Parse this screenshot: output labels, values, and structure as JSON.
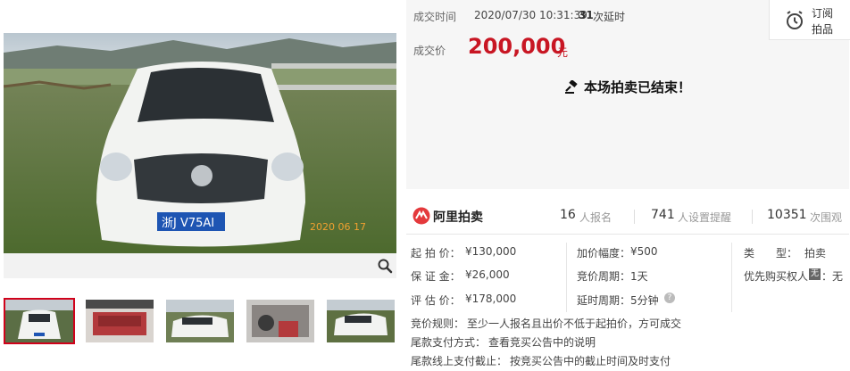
{
  "deal": {
    "time_label": "成交时间",
    "time_value": "2020/07/30 10:31:39",
    "delay_count": "31",
    "delay_label": "次延时",
    "price_label": "成交价",
    "price_value": "200,000",
    "price_unit": "元"
  },
  "subscribe": {
    "line1": "订阅",
    "line2": "拍品"
  },
  "status_message": "本场拍卖已结束！",
  "photo": {
    "plate": "浙J V75AI",
    "date_stamp": "2020 06 17"
  },
  "brand": {
    "name": "阿里拍卖"
  },
  "stats": [
    {
      "num": "16",
      "label": "人报名"
    },
    {
      "num": "741",
      "label": "人设置提醒"
    },
    {
      "num": "10351",
      "label": "次围观"
    }
  ],
  "details": {
    "col1": [
      {
        "label": "起 拍 价：",
        "value": "¥130,000"
      },
      {
        "label": "保 证 金：",
        "value": "¥26,000"
      },
      {
        "label": "评 估 价：",
        "value": "¥178,000"
      }
    ],
    "col2": [
      {
        "label": "加价幅度：",
        "value": "¥500"
      },
      {
        "label": "竞价周期：",
        "value": "1天"
      },
      {
        "label": "延时周期：",
        "value": "5分钟"
      }
    ],
    "col3": [
      {
        "label": "类　　型：",
        "value": "拍卖"
      },
      {
        "label": "优先购买权人",
        "badge": "无",
        "value": "：无"
      }
    ]
  },
  "rules": [
    {
      "label": "竞价规则：",
      "value": "至少一人报名且出价不低于起拍价，方可成交"
    },
    {
      "label": "尾款支付方式：",
      "value": "查看竞买公告中的说明"
    },
    {
      "label": "尾款线上支付截止：",
      "value": "按竞买公告中的截止时间及时支付"
    }
  ],
  "colors": {
    "price": "#c81623",
    "accent": "#d0021b",
    "brand_logo": "#e4393c"
  }
}
